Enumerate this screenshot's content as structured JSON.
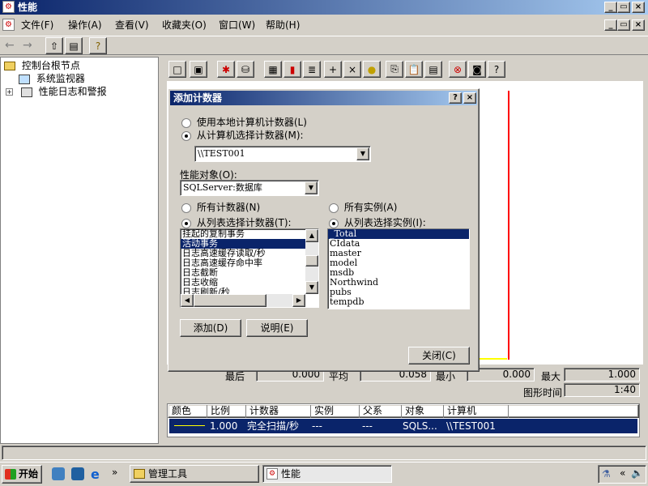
{
  "window": {
    "title": "性能"
  },
  "menu": [
    "文件(F)",
    "操作(A)",
    "查看(V)",
    "收藏夹(O)",
    "窗口(W)",
    "帮助(H)"
  ],
  "tree": {
    "root": "控制台根节点",
    "items": [
      "系统监视器",
      "性能日志和警报"
    ]
  },
  "dialog": {
    "title": "添加计数器",
    "radio_local": "使用本地计算机计数器(L)",
    "radio_select": "从计算机选择计数器(M):",
    "computer_value": "\\\\TEST001",
    "perf_object_label": "性能对象(O):",
    "perf_object_value": "SQLServer:数据库",
    "all_counters": "所有计数器(N)",
    "select_counters": "从列表选择计数器(T):",
    "all_instances": "所有实例(A)",
    "select_instances": "从列表选择实例(I):",
    "counters": [
      "挂起的复制事务",
      "活动事务",
      "日志高速缓存读取/秒",
      "日志高速缓存命中率",
      "日志截断",
      "日志收缩",
      "日志刷新/秒"
    ],
    "selected_counter_index": 1,
    "instances": [
      "_Total",
      "CIdata",
      "master",
      "model",
      "msdb",
      "Northwind",
      "pubs",
      "tempdb"
    ],
    "selected_instance_index": 0,
    "add_button": "添加(D)",
    "explain_button": "说明(E)",
    "close_button": "关闭(C)"
  },
  "stats": {
    "last_label": "最后",
    "last_value": "0.000",
    "avg_label": "平均",
    "avg_value": "0.058",
    "min_label": "最小",
    "min_value": "0.000",
    "max_label": "最大",
    "max_value": "1.000",
    "duration_label": "图形时间",
    "duration_value": "1:40"
  },
  "counter_table": {
    "headers": [
      "颜色",
      "比例",
      "计数器",
      "实例",
      "父系",
      "对象",
      "计算机"
    ],
    "row": {
      "scale": "1.000",
      "counter": "完全扫描/秒",
      "instance": "---",
      "parent": "---",
      "object": "SQLS...",
      "computer": "\\\\TEST001"
    }
  },
  "taskbar": {
    "start": "开始",
    "tasks": [
      "管理工具",
      "性能"
    ]
  },
  "colors": {
    "title": "#0a246a",
    "graph_line": "#ff0000",
    "selection": "#0a246a"
  }
}
